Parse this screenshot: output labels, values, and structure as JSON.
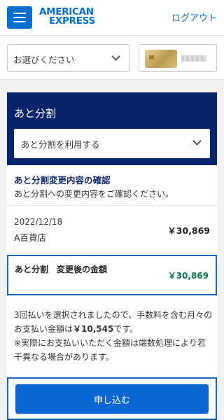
{
  "header": {
    "logo_line1": "AMERICAN",
    "logo_line2": "EXPRESS",
    "logout_label": "ログアウト"
  },
  "account_select": {
    "placeholder": "お選びください"
  },
  "panel": {
    "title": "あと分割",
    "option_select": "あと分割を利用する"
  },
  "confirmation": {
    "title": "あと分割変更内容の確認",
    "description": "あと分割への変更内容をご確認ください。"
  },
  "transaction": {
    "date": "2022/12/18",
    "store": "A百貨店",
    "amount": "￥30,869"
  },
  "after_change": {
    "label": "あと分割　変更後の金額",
    "amount": "￥30,869",
    "color": "#0a7a4a"
  },
  "notice": {
    "part1": "3回払いを選択されましたので、手数料を含む月々のお支払い金額は",
    "monthly_amount": "￥10,545",
    "part2": "です。",
    "note": "※実際にお支払いいただく金額は端数処理により若干異なる場合があります。"
  },
  "actions": {
    "apply_label": "申し込む"
  },
  "colors": {
    "brand_blue": "#006fcf",
    "panel_navy": "#07246b",
    "button_blue": "#0a66d3",
    "highlight_border": "#1565c0"
  }
}
